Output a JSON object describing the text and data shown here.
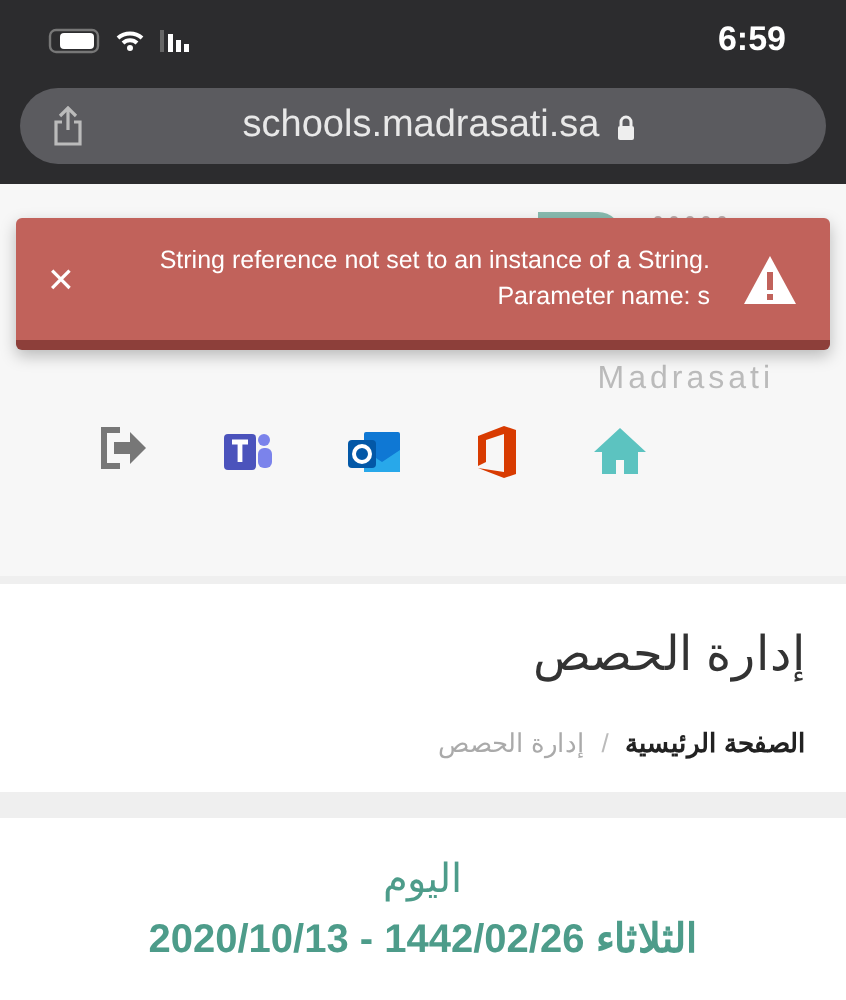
{
  "status_bar": {
    "time": "6:59"
  },
  "address_bar": {
    "url": "schools.madrasati.sa"
  },
  "logo": {
    "text": "Madrasati"
  },
  "alert": {
    "message": "String reference not set to an instance of a String.",
    "detail": "Parameter name: s",
    "close": "×"
  },
  "toolbar_icons": [
    {
      "kind": "logout"
    },
    {
      "kind": "teams"
    },
    {
      "kind": "outlook"
    },
    {
      "kind": "office"
    },
    {
      "kind": "home"
    }
  ],
  "page_header": {
    "title": "إدارة الحصص",
    "breadcrumb_separator": "/",
    "breadcrumb": [
      {
        "label": "الصفحة الرئيسية",
        "selected": false
      },
      {
        "label": "إدارة الحصص",
        "selected": true
      }
    ]
  },
  "day_card": {
    "label": "اليوم",
    "date": "الثلاثاء 1442/02/26 - 2020/10/13"
  }
}
